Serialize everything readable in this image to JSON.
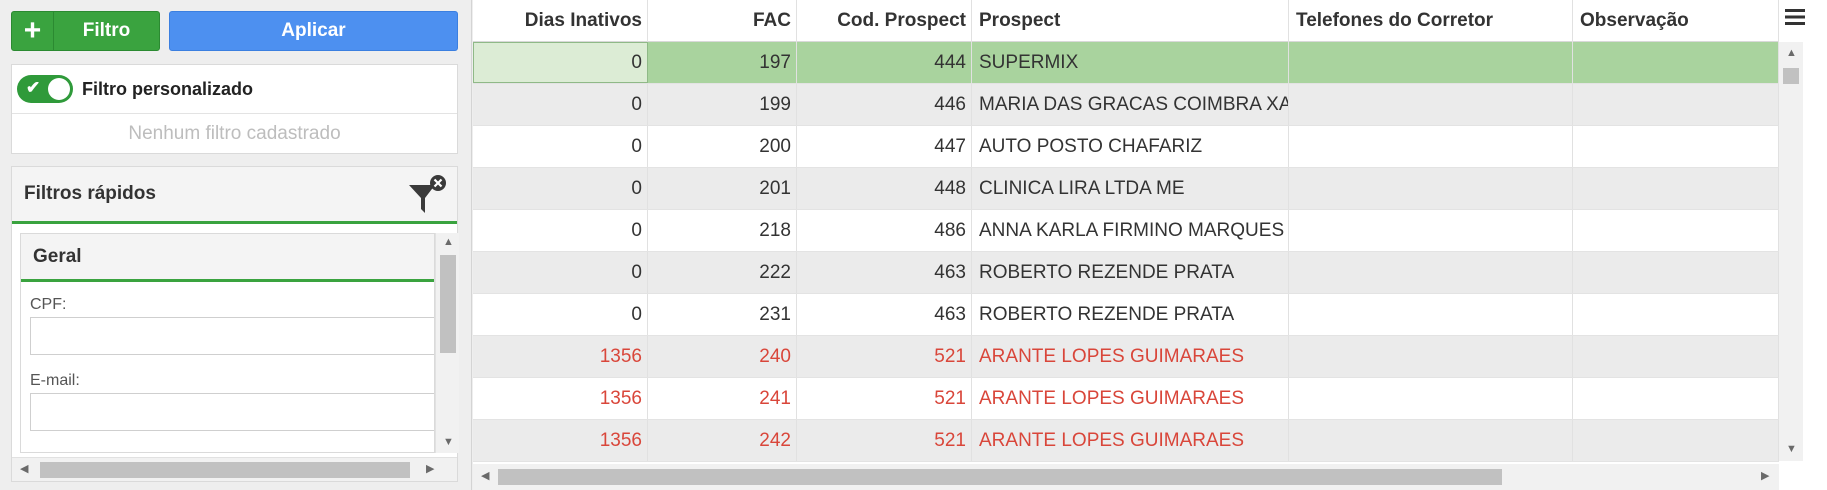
{
  "toolbar": {
    "filter_icon": "plus-icon",
    "filter_label": "Filtro",
    "apply_label": "Aplicar",
    "filter_color": "#3aa33f",
    "apply_color": "#4d90f0"
  },
  "custom_filter": {
    "toggle_on": true,
    "label": "Filtro personalizado",
    "empty_message": "Nenhum filtro cadastrado"
  },
  "quick_filters": {
    "title": "Filtros rápidos",
    "clear_icon": "filter-clear-icon",
    "group_title": "Geral",
    "fields": [
      {
        "label": "CPF:",
        "value": ""
      },
      {
        "label": "E-mail:",
        "value": ""
      }
    ]
  },
  "grid": {
    "columns": [
      "Dias Inativos",
      "FAC",
      "Cod. Prospect",
      "Prospect",
      "Telefones do Corretor",
      "Observação"
    ],
    "menu_icon": "hamburger-menu-icon",
    "highlight_color": "#d9463a",
    "selected_color": "#a9d39e",
    "rows": [
      {
        "dias": "0",
        "fac": "197",
        "cod": "444",
        "prospect": "SUPERMIX",
        "telefones": "",
        "obs": "",
        "selected": true,
        "highlight": false
      },
      {
        "dias": "0",
        "fac": "199",
        "cod": "446",
        "prospect": "MARIA DAS GRACAS COIMBRA XAVIER",
        "telefones": "",
        "obs": "",
        "selected": false,
        "highlight": false
      },
      {
        "dias": "0",
        "fac": "200",
        "cod": "447",
        "prospect": "AUTO POSTO CHAFARIZ",
        "telefones": "",
        "obs": "",
        "selected": false,
        "highlight": false
      },
      {
        "dias": "0",
        "fac": "201",
        "cod": "448",
        "prospect": "CLINICA LIRA LTDA ME",
        "telefones": "",
        "obs": "",
        "selected": false,
        "highlight": false
      },
      {
        "dias": "0",
        "fac": "218",
        "cod": "486",
        "prospect": "ANNA KARLA FIRMINO MARQUES",
        "telefones": "",
        "obs": "",
        "selected": false,
        "highlight": false
      },
      {
        "dias": "0",
        "fac": "222",
        "cod": "463",
        "prospect": "ROBERTO REZENDE PRATA",
        "telefones": "",
        "obs": "",
        "selected": false,
        "highlight": false
      },
      {
        "dias": "0",
        "fac": "231",
        "cod": "463",
        "prospect": "ROBERTO REZENDE PRATA",
        "telefones": "",
        "obs": "",
        "selected": false,
        "highlight": false
      },
      {
        "dias": "1356",
        "fac": "240",
        "cod": "521",
        "prospect": "ARANTE LOPES GUIMARAES",
        "telefones": "",
        "obs": "",
        "selected": false,
        "highlight": true
      },
      {
        "dias": "1356",
        "fac": "241",
        "cod": "521",
        "prospect": "ARANTE LOPES GUIMARAES",
        "telefones": "",
        "obs": "",
        "selected": false,
        "highlight": true
      },
      {
        "dias": "1356",
        "fac": "242",
        "cod": "521",
        "prospect": "ARANTE LOPES GUIMARAES",
        "telefones": "",
        "obs": "",
        "selected": false,
        "highlight": true
      }
    ]
  }
}
